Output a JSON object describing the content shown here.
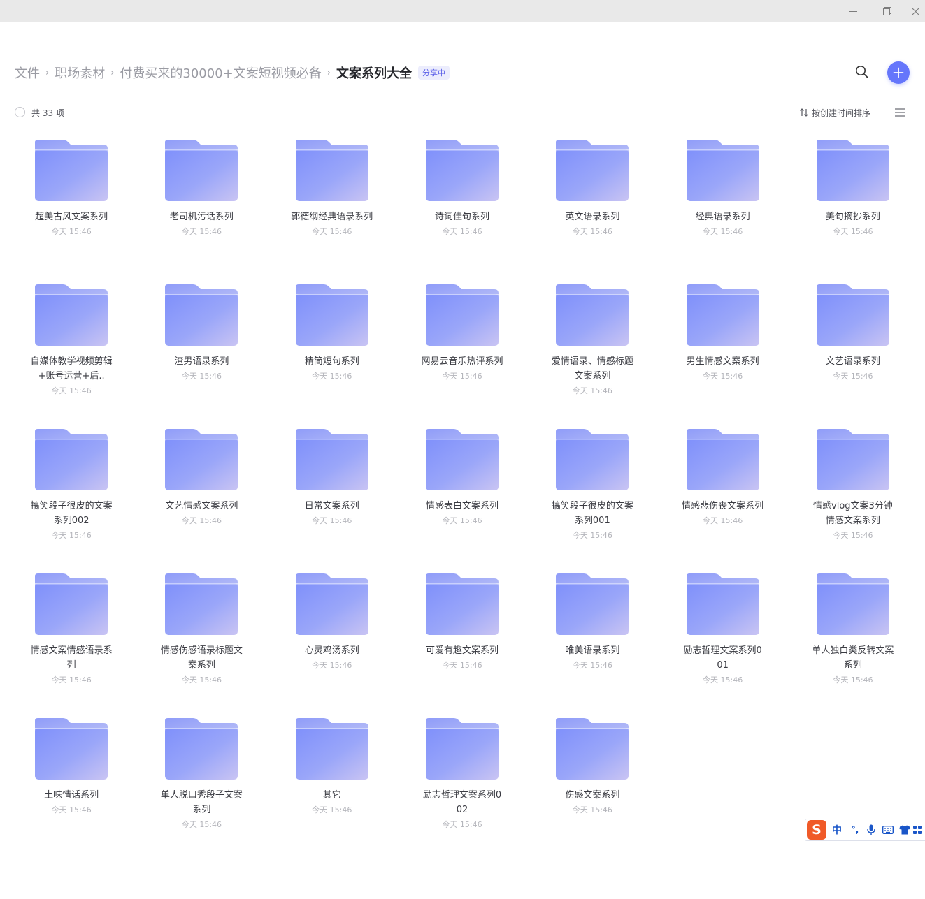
{
  "window": {
    "controls": [
      "minimize-icon",
      "maximize-icon",
      "close-icon"
    ]
  },
  "breadcrumb": {
    "items": [
      "文件",
      "职场素材",
      "付费买来的30000+文案短视频必备"
    ],
    "current": "文案系列大全",
    "badge": "分享中"
  },
  "header": {
    "search_icon": "search-icon",
    "add_icon": "plus-icon",
    "accent_color": "#6576fb"
  },
  "toolbar": {
    "count_label": "共 33 项",
    "sort_label": "按创建时间排序",
    "sort_icon": "sort-arrows-icon",
    "view_icon": "list-view-icon"
  },
  "folders": [
    {
      "name": "超美古风文案系列",
      "time": "今天 15:46"
    },
    {
      "name": "老司机污话系列",
      "time": "今天 15:46"
    },
    {
      "name": "郭德纲经典语录系列",
      "time": "今天 15:46"
    },
    {
      "name": "诗词佳句系列",
      "time": "今天 15:46"
    },
    {
      "name": "英文语录系列",
      "time": "今天 15:46"
    },
    {
      "name": "经典语录系列",
      "time": "今天 15:46"
    },
    {
      "name": "美句摘抄系列",
      "time": "今天 15:46"
    },
    {
      "name": "自媒体教学视频剪辑+账号运营+后..",
      "time": "今天 15:46"
    },
    {
      "name": "渣男语录系列",
      "time": "今天 15:46"
    },
    {
      "name": "精简短句系列",
      "time": "今天 15:46"
    },
    {
      "name": "网易云音乐热评系列",
      "time": "今天 15:46"
    },
    {
      "name": "爱情语录、情感标题文案系列",
      "time": "今天 15:46"
    },
    {
      "name": "男生情感文案系列",
      "time": "今天 15:46"
    },
    {
      "name": "文艺语录系列",
      "time": "今天 15:46"
    },
    {
      "name": "搞笑段子很皮的文案系列002",
      "time": "今天 15:46"
    },
    {
      "name": "文艺情感文案系列",
      "time": "今天 15:46"
    },
    {
      "name": "日常文案系列",
      "time": "今天 15:46"
    },
    {
      "name": "情感表白文案系列",
      "time": "今天 15:46"
    },
    {
      "name": "搞笑段子很皮的文案系列001",
      "time": "今天 15:46"
    },
    {
      "name": "情感悲伤丧文案系列",
      "time": "今天 15:46"
    },
    {
      "name": "情感vlog文案3分钟情感文案系列",
      "time": "今天 15:46"
    },
    {
      "name": "情感文案情感语录系列",
      "time": "今天 15:46"
    },
    {
      "name": "情感伤感语录标题文案系列",
      "time": "今天 15:46"
    },
    {
      "name": "心灵鸡汤系列",
      "time": "今天 15:46"
    },
    {
      "name": "可爱有趣文案系列",
      "time": "今天 15:46"
    },
    {
      "name": "唯美语录系列",
      "time": "今天 15:46"
    },
    {
      "name": "励志哲理文案系列001",
      "time": "今天 15:46"
    },
    {
      "name": "单人独白类反转文案系列",
      "time": "今天 15:46"
    },
    {
      "name": "土味情话系列",
      "time": "今天 15:46"
    },
    {
      "name": "单人脱口秀段子文案系列",
      "time": "今天 15:46"
    },
    {
      "name": "其它",
      "time": "今天 15:46"
    },
    {
      "name": "励志哲理文案系列002",
      "time": "今天 15:46"
    },
    {
      "name": "伤感文案系列",
      "time": "今天 15:46"
    }
  ],
  "ime": {
    "logo": "S",
    "lang": "中",
    "punct": "°,",
    "items": [
      "microphone-icon",
      "keyboard-icon",
      "shirt-icon",
      "grid-icon"
    ]
  }
}
